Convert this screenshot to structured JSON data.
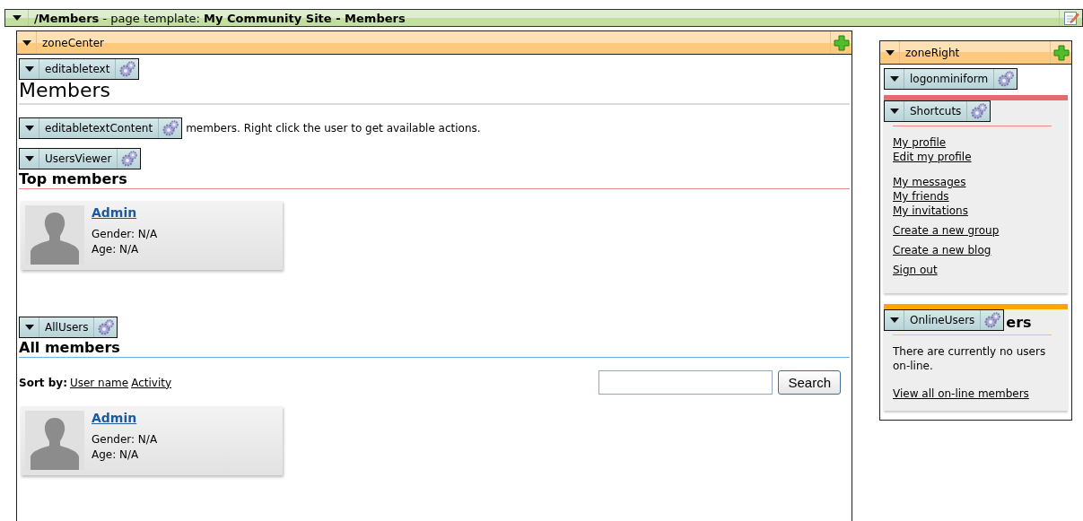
{
  "page_bar": {
    "path": "/Members",
    "separator": "- page template:",
    "template": "My Community Site - Members"
  },
  "zone_center": {
    "title": "zoneCenter",
    "editable_title": {
      "tag": "editabletext",
      "heading": "Members"
    },
    "editable_content": {
      "tag": "editabletextContent",
      "text": "members. Right click the user to get available actions."
    },
    "top_members": {
      "tag": "UsersViewer",
      "heading": "Top members",
      "members": [
        {
          "name": "Admin",
          "gender": "Gender: N/A",
          "age": "Age: N/A"
        }
      ]
    },
    "all_members": {
      "tag": "AllUsers",
      "heading": "All members",
      "sort_label": "Sort by:",
      "sort_links": [
        "User name",
        "Activity"
      ],
      "search_button": "Search",
      "members": [
        {
          "name": "Admin",
          "gender": "Gender: N/A",
          "age": "Age: N/A"
        }
      ]
    }
  },
  "zone_right": {
    "title": "zoneRight",
    "logon": {
      "tag": "logonminiform"
    },
    "shortcuts": {
      "tag": "Shortcuts",
      "groups": [
        [
          "My profile",
          "Edit my profile"
        ],
        [
          "My messages",
          "My friends",
          "My invitations"
        ],
        [
          "Create a new group"
        ],
        [
          "Create a new blog"
        ],
        [
          "Sign out"
        ]
      ]
    },
    "online": {
      "tag": "OnlineUsers",
      "heading": "ers",
      "text": "There are currently no users on-line.",
      "link": "View all on-line members"
    }
  }
}
